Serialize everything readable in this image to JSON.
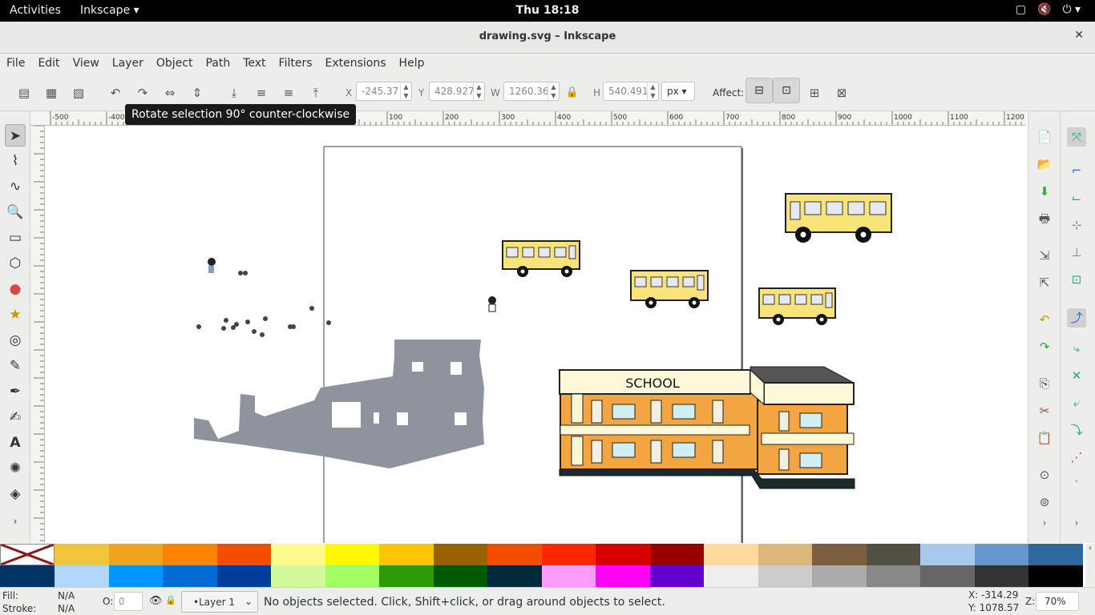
{
  "topbar": {
    "activities": "Activities",
    "app_name": "Inkscape",
    "clock": "Thu 18:18"
  },
  "window": {
    "title": "drawing.svg – Inkscape"
  },
  "menu": [
    "File",
    "Edit",
    "View",
    "Layer",
    "Object",
    "Path",
    "Text",
    "Filters",
    "Extensions",
    "Help"
  ],
  "toolbar": {
    "x_label": "X",
    "x_value": "-245.37",
    "y_label": "Y",
    "y_value": "428.927",
    "w_label": "W",
    "w_value": "1260.36",
    "h_label": "H",
    "h_value": "540.491",
    "unit": "px",
    "affect_label": "Affect:"
  },
  "tooltip": "Rotate selection 90° counter-clockwise",
  "ruler": {
    "h_ticks": [
      "-500",
      "-400",
      "-300",
      "-200",
      "-100",
      "0",
      "100",
      "200",
      "300",
      "400",
      "500",
      "600",
      "700",
      "800",
      "900",
      "1000",
      "1100",
      "1200"
    ],
    "v_ticks": [
      "1\n0\n0",
      "0",
      "1\n0\n0",
      "2\n0\n0",
      "3\n0\n0",
      "4\n0\n0",
      "5\n0\n0",
      "6\n0\n0",
      "7\n0\n0",
      "8\n0\n0",
      "9\n0\n0"
    ]
  },
  "canvas": {
    "school_sign": "SCHOOL"
  },
  "status": {
    "fill_label": "Fill:",
    "fill_value": "N/A",
    "stroke_label": "Stroke:",
    "stroke_value": "N/A",
    "opacity_label": "O:",
    "opacity_value": "0",
    "layer": "•Layer 1",
    "message": "No objects selected. Click, Shift+click, or drag around objects to select.",
    "cursor_x": "X: -314.29",
    "cursor_y": "Y: 1078.57",
    "zoom_label": "Z:",
    "zoom_value": "70%"
  },
  "colors": {
    "accent_bus": "#f9e47a",
    "school_wall": "#f2a541",
    "silhouette": "#8e939e"
  }
}
